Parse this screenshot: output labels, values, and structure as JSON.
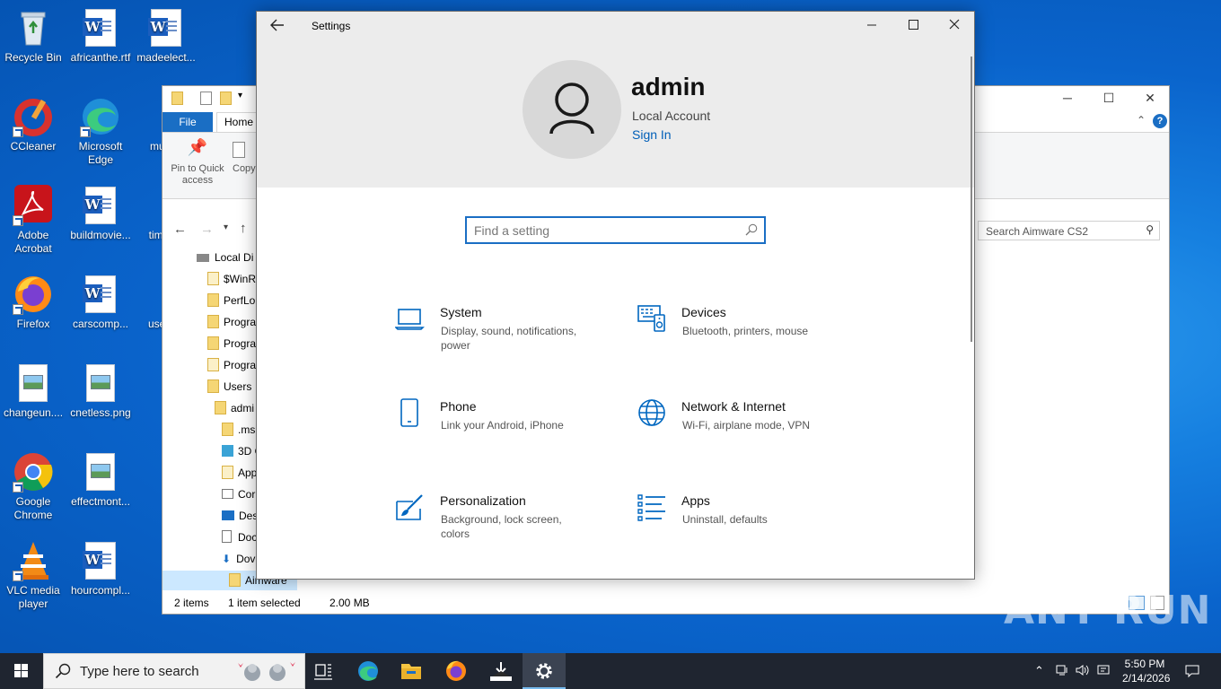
{
  "desktop": {
    "icons": [
      {
        "label": "Recycle Bin"
      },
      {
        "label": "africanthe.rtf"
      },
      {
        "label": "madeelect..."
      },
      {
        "label": "CCleaner"
      },
      {
        "label": "Microsoft Edge"
      },
      {
        "label": "must..."
      },
      {
        "label": "Adobe Acrobat"
      },
      {
        "label": "buildmovie..."
      },
      {
        "label": "times..."
      },
      {
        "label": "Firefox"
      },
      {
        "label": "carscomp..."
      },
      {
        "label": "userp..."
      },
      {
        "label": "changeun...."
      },
      {
        "label": "cnetless.png"
      },
      {
        "label": "Google Chrome"
      },
      {
        "label": "effectmont..."
      },
      {
        "label": "VLC media player"
      },
      {
        "label": "hourcompl..."
      }
    ],
    "watermark": "ANY RUN"
  },
  "explorer": {
    "tabs": {
      "file": "File",
      "home": "Home"
    },
    "ribbon": {
      "pin": "Pin to Quick access",
      "copy": "Copy"
    },
    "search_placeholder": "Search Aimware CS2",
    "tree": [
      {
        "label": "Local Di"
      },
      {
        "label": "$WinR"
      },
      {
        "label": "PerfLo"
      },
      {
        "label": "Progra"
      },
      {
        "label": "Progra"
      },
      {
        "label": "Progra"
      },
      {
        "label": "Users"
      },
      {
        "label": "admi"
      },
      {
        "label": ".ms"
      },
      {
        "label": "3D O"
      },
      {
        "label": "App"
      },
      {
        "label": "Cor"
      },
      {
        "label": "Des"
      },
      {
        "label": "Doc"
      },
      {
        "label": "Dov"
      },
      {
        "label": "Aimware"
      }
    ],
    "status": {
      "items": "2 items",
      "selected": "1 item selected",
      "size": "2.00 MB"
    }
  },
  "settings": {
    "title": "Settings",
    "user": {
      "name": "admin",
      "account": "Local Account",
      "sign_in": "Sign In"
    },
    "search_placeholder": "Find a setting",
    "categories": [
      {
        "name": "System",
        "desc": "Display, sound, notifications, power",
        "icon": "laptop-icon"
      },
      {
        "name": "Devices",
        "desc": "Bluetooth, printers, mouse",
        "icon": "devices-icon"
      },
      {
        "name": "Phone",
        "desc": "Link your Android, iPhone",
        "icon": "phone-icon"
      },
      {
        "name": "Network & Internet",
        "desc": "Wi-Fi, airplane mode, VPN",
        "icon": "globe-icon"
      },
      {
        "name": "Personalization",
        "desc": "Background, lock screen, colors",
        "icon": "paint-icon"
      },
      {
        "name": "Apps",
        "desc": "Uninstall, defaults",
        "icon": "apps-list-icon"
      }
    ]
  },
  "taskbar": {
    "search_text": "Type here to search",
    "time": "5:50 PM",
    "date": "2/14/2026"
  },
  "colors": {
    "accent": "#005fb8",
    "icon_blue": "#0067c0",
    "taskbar": "#1f2530"
  }
}
